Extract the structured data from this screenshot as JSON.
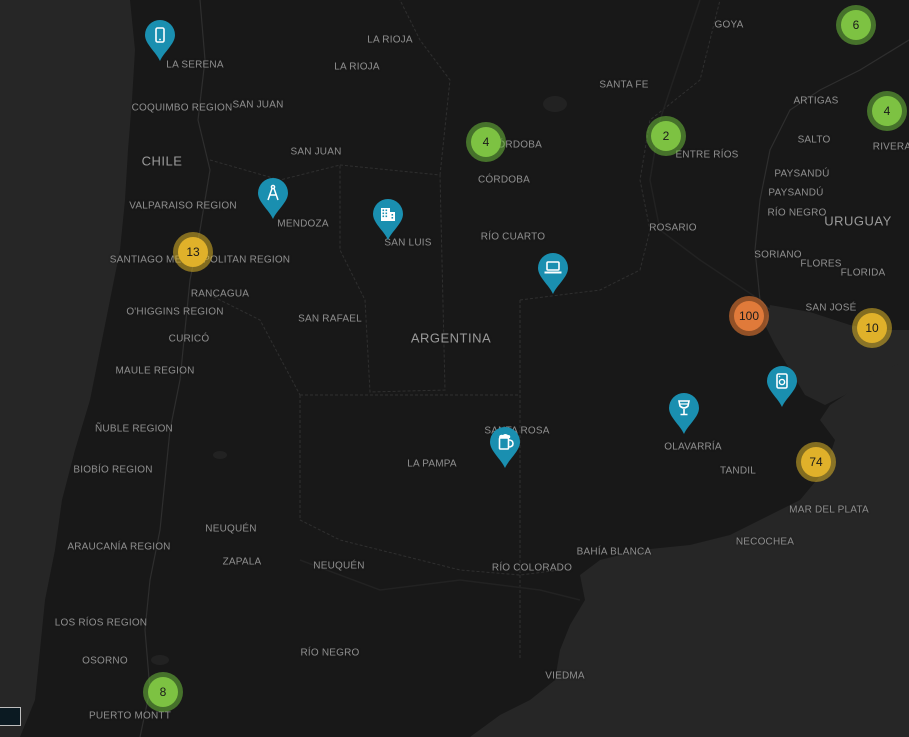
{
  "labels": [
    {
      "text": "GOYA",
      "type": "city"
    },
    {
      "text": "LA RIOJA",
      "type": "region"
    },
    {
      "text": "LA RIOJA",
      "type": "city"
    },
    {
      "text": "LA SERENA",
      "type": "city"
    },
    {
      "text": "SANTA FE",
      "type": "region"
    },
    {
      "text": "ARTIGAS",
      "type": "region"
    },
    {
      "text": "COQUIMBO REGION",
      "type": "region"
    },
    {
      "text": "SAN JUAN",
      "type": "city"
    },
    {
      "text": "SALTO",
      "type": "region"
    },
    {
      "text": "RIVERA",
      "type": "region"
    },
    {
      "text": "CÓRDOBA",
      "type": "city"
    },
    {
      "text": "SAN JUAN",
      "type": "region"
    },
    {
      "text": "ENTRE RÍOS",
      "type": "region"
    },
    {
      "text": "CHILE",
      "type": "country"
    },
    {
      "text": "PAYSANDÚ",
      "type": "region"
    },
    {
      "text": "CÓRDOBA",
      "type": "region"
    },
    {
      "text": "PAYSANDÚ",
      "type": "city"
    },
    {
      "text": "VALPARAISO REGION",
      "type": "region"
    },
    {
      "text": "RÍO NEGRO",
      "type": "region"
    },
    {
      "text": "MENDOZA",
      "type": "region"
    },
    {
      "text": "URUGUAY",
      "type": "country"
    },
    {
      "text": "SAN LUIS",
      "type": "region"
    },
    {
      "text": "ROSARIO",
      "type": "city"
    },
    {
      "text": "RÍO CUARTO",
      "type": "city"
    },
    {
      "text": "SANTIAGO METROPOLITAN REGION",
      "type": "region"
    },
    {
      "text": "SORIANO",
      "type": "region"
    },
    {
      "text": "FLORES",
      "type": "region"
    },
    {
      "text": "FLORIDA",
      "type": "region"
    },
    {
      "text": "RANCAGUA",
      "type": "city"
    },
    {
      "text": "SAN JOSÉ",
      "type": "region"
    },
    {
      "text": "O'HIGGINS REGION",
      "type": "region"
    },
    {
      "text": "SAN RAFAEL",
      "type": "city"
    },
    {
      "text": "ARGENTINA",
      "type": "country"
    },
    {
      "text": "CURICÓ",
      "type": "city"
    },
    {
      "text": "MAULE REGION",
      "type": "region"
    },
    {
      "text": "SANTA ROSA",
      "type": "city"
    },
    {
      "text": "ÑUBLE REGION",
      "type": "region"
    },
    {
      "text": "OLAVARRÍA",
      "type": "city"
    },
    {
      "text": "LA PAMPA",
      "type": "region"
    },
    {
      "text": "BIOBÍO REGION",
      "type": "region"
    },
    {
      "text": "TANDIL",
      "type": "city"
    },
    {
      "text": "MAR DEL PLATA",
      "type": "city"
    },
    {
      "text": "NEUQUÉN",
      "type": "city"
    },
    {
      "text": "ARAUCANÍA REGION",
      "type": "region"
    },
    {
      "text": "NECOCHEA",
      "type": "city"
    },
    {
      "text": "BAHÍA BLANCA",
      "type": "city"
    },
    {
      "text": "ZAPALA",
      "type": "city"
    },
    {
      "text": "NEUQUÉN",
      "type": "region"
    },
    {
      "text": "RÍO COLORADO",
      "type": "city"
    },
    {
      "text": "LOS RÍOS REGION",
      "type": "region"
    },
    {
      "text": "OSORNO",
      "type": "city"
    },
    {
      "text": "RÍO NEGRO",
      "type": "region"
    },
    {
      "text": "VIEDMA",
      "type": "city"
    },
    {
      "text": "PUERTO MONTT",
      "type": "city"
    }
  ],
  "clusters": [
    {
      "count": "6",
      "level": "green"
    },
    {
      "count": "4",
      "level": "green"
    },
    {
      "count": "4",
      "level": "green"
    },
    {
      "count": "2",
      "level": "green"
    },
    {
      "count": "13",
      "level": "yellow"
    },
    {
      "count": "100",
      "level": "orange"
    },
    {
      "count": "10",
      "level": "yellow"
    },
    {
      "count": "74",
      "level": "yellow"
    },
    {
      "count": "8",
      "level": "green"
    }
  ],
  "markers": [
    {
      "icon": "smartphone-icon"
    },
    {
      "icon": "compass-icon"
    },
    {
      "icon": "office-building-icon"
    },
    {
      "icon": "laptop-icon"
    },
    {
      "icon": "tablet-icon"
    },
    {
      "icon": "wine-glass-icon"
    },
    {
      "icon": "beer-mug-icon"
    }
  ],
  "colors": {
    "water": "#262626",
    "land": "#181818",
    "marker": "#1a8fb0",
    "cluster_green": "#7dc242",
    "cluster_yellow": "#e0b12a",
    "cluster_orange": "#e07a3a"
  }
}
